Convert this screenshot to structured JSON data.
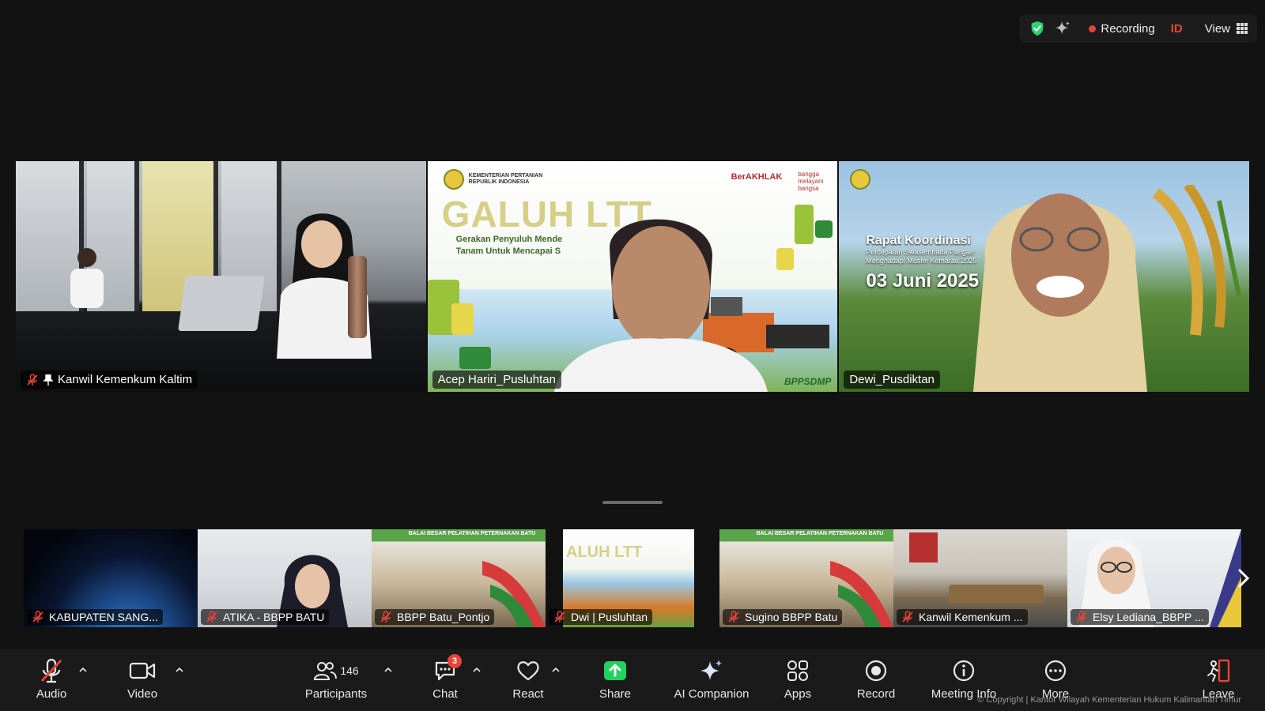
{
  "status_bar": {
    "recording_label": "Recording",
    "id_label": "ID",
    "view_label": "View",
    "colors": {
      "secure": "#2bd46f",
      "recording": "#e8443a"
    }
  },
  "main_tiles": [
    {
      "name": "Kanwil Kemenkum Kaltim",
      "muted": true,
      "pinned": true,
      "active": false
    },
    {
      "name": "Acep Hariri_Pusluhtan",
      "muted": false,
      "active": false,
      "slide": {
        "org": [
          "KEMENTERIAN PERTANIAN",
          "REPUBLIK INDONESIA"
        ],
        "title": "GALUH LTT",
        "subtitle": [
          "Gerakan Penyuluh Mende",
          "Tanam Untuk Mencapai S"
        ],
        "brand_a": "BerAKHLAK",
        "brand_b": [
          "bangga",
          "melayani",
          "bangsa"
        ],
        "footer": "BPPSDMP"
      }
    },
    {
      "name": "Dewi_Pusdiktan",
      "muted": false,
      "active": true,
      "slide": {
        "title": "Rapat Koordinasi",
        "subtitle": [
          "Percepatan Swasembada Pangan",
          "Menghadapi Musim Kemarau 2025"
        ],
        "date": "03 Juni 2025"
      }
    }
  ],
  "thumbnails": [
    {
      "name": "KABUPATEN SANG...",
      "muted": true
    },
    {
      "name": "ATIKA - BBPP BATU",
      "muted": true
    },
    {
      "name": "BBPP Batu_Pontjo",
      "muted": true,
      "banner": "BALAI BESAR PELATIHAN PETERNAKAN BATU"
    },
    {
      "name": "Dwi | Pusluhtan",
      "muted": true,
      "slide_title": "ALUH LTT"
    },
    {
      "name": "Sugino  BBPP Batu",
      "muted": true,
      "banner": "BALAI BESAR PELATIHAN PETERNAKAN BATU"
    },
    {
      "name": "Kanwil Kemenkum ...",
      "muted": true
    },
    {
      "name": "Elsy Lediana_BBPP ...",
      "muted": true
    }
  ],
  "toolbar": {
    "audio": "Audio",
    "video": "Video",
    "participants": "Participants",
    "participants_count": "146",
    "chat": "Chat",
    "chat_badge": "3",
    "react": "React",
    "share": "Share",
    "ai_companion": "AI Companion",
    "apps": "Apps",
    "record": "Record",
    "meeting_info": "Meeting Info",
    "more": "More",
    "leave": "Leave",
    "share_color": "#23d160",
    "leave_color": "#e8443a"
  },
  "watermark": "© Copyright | Kantor Wilayah Kementerian Hukum Kalimantan Timur"
}
